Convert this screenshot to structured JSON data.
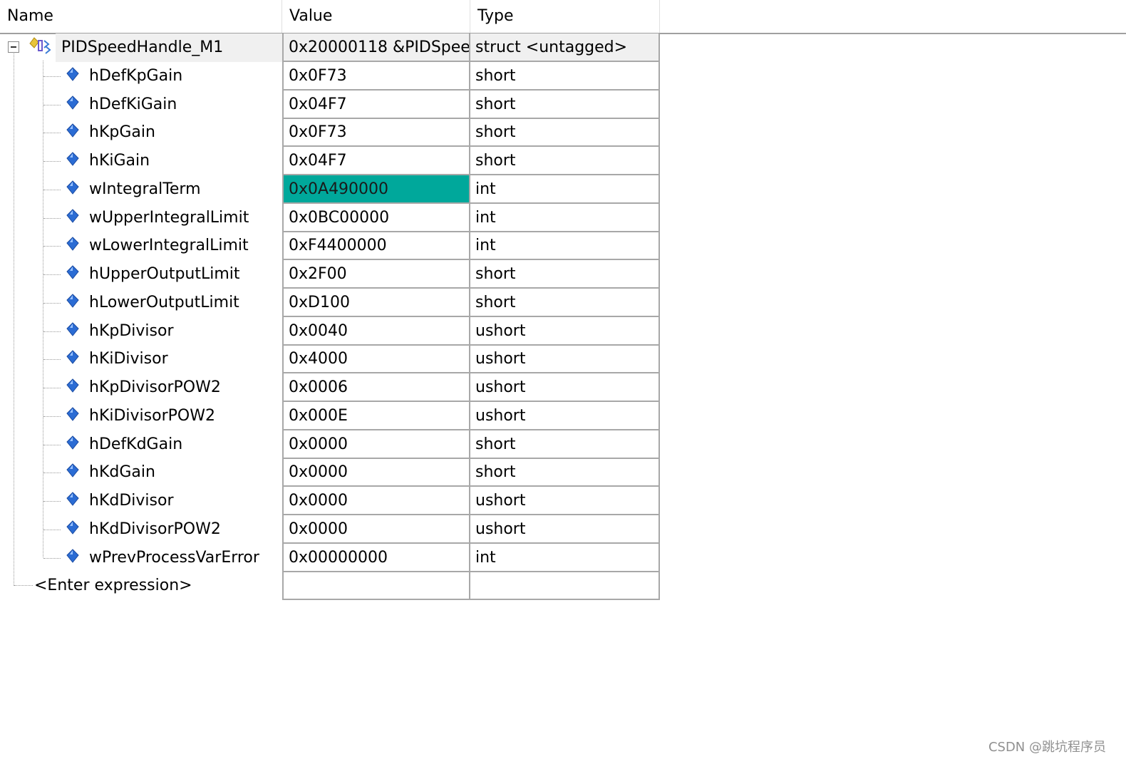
{
  "columns": {
    "name": "Name",
    "value": "Value",
    "type": "Type"
  },
  "root": {
    "name": "PIDSpeedHandle_M1",
    "value": "0x20000118 &PIDSpee...",
    "type": "struct <untagged>",
    "expanded": true
  },
  "members": [
    {
      "name": "hDefKpGain",
      "value": "0x0F73",
      "type": "short"
    },
    {
      "name": "hDefKiGain",
      "value": "0x04F7",
      "type": "short"
    },
    {
      "name": "hKpGain",
      "value": "0x0F73",
      "type": "short"
    },
    {
      "name": "hKiGain",
      "value": "0x04F7",
      "type": "short"
    },
    {
      "name": "wIntegralTerm",
      "value": "0x0A490000",
      "type": "int",
      "highlighted": true
    },
    {
      "name": "wUpperIntegralLimit",
      "value": "0x0BC00000",
      "type": "int"
    },
    {
      "name": "wLowerIntegralLimit",
      "value": "0xF4400000",
      "type": "int"
    },
    {
      "name": "hUpperOutputLimit",
      "value": "0x2F00",
      "type": "short"
    },
    {
      "name": "hLowerOutputLimit",
      "value": "0xD100",
      "type": "short"
    },
    {
      "name": "hKpDivisor",
      "value": "0x0040",
      "type": "ushort"
    },
    {
      "name": "hKiDivisor",
      "value": "0x4000",
      "type": "ushort"
    },
    {
      "name": "hKpDivisorPOW2",
      "value": "0x0006",
      "type": "ushort"
    },
    {
      "name": "hKiDivisorPOW2",
      "value": "0x000E",
      "type": "ushort"
    },
    {
      "name": "hDefKdGain",
      "value": "0x0000",
      "type": "short"
    },
    {
      "name": "hKdGain",
      "value": "0x0000",
      "type": "short"
    },
    {
      "name": "hKdDivisor",
      "value": "0x0000",
      "type": "ushort"
    },
    {
      "name": "hKdDivisorPOW2",
      "value": "0x0000",
      "type": "ushort"
    },
    {
      "name": "wPrevProcessVarError",
      "value": "0x00000000",
      "type": "int"
    }
  ],
  "enter_expression": {
    "label": "<Enter expression>",
    "value": "",
    "type": ""
  },
  "watermark": "CSDN @跳坑程序员",
  "colors": {
    "highlight": "#00a89b",
    "root_row_bg": "#f0f0f0",
    "member_icon": "#2b6cd4"
  },
  "icons": {
    "member": "diamond-member-icon",
    "root": "struct-variable-icon",
    "expander": "collapse-minus-icon"
  }
}
